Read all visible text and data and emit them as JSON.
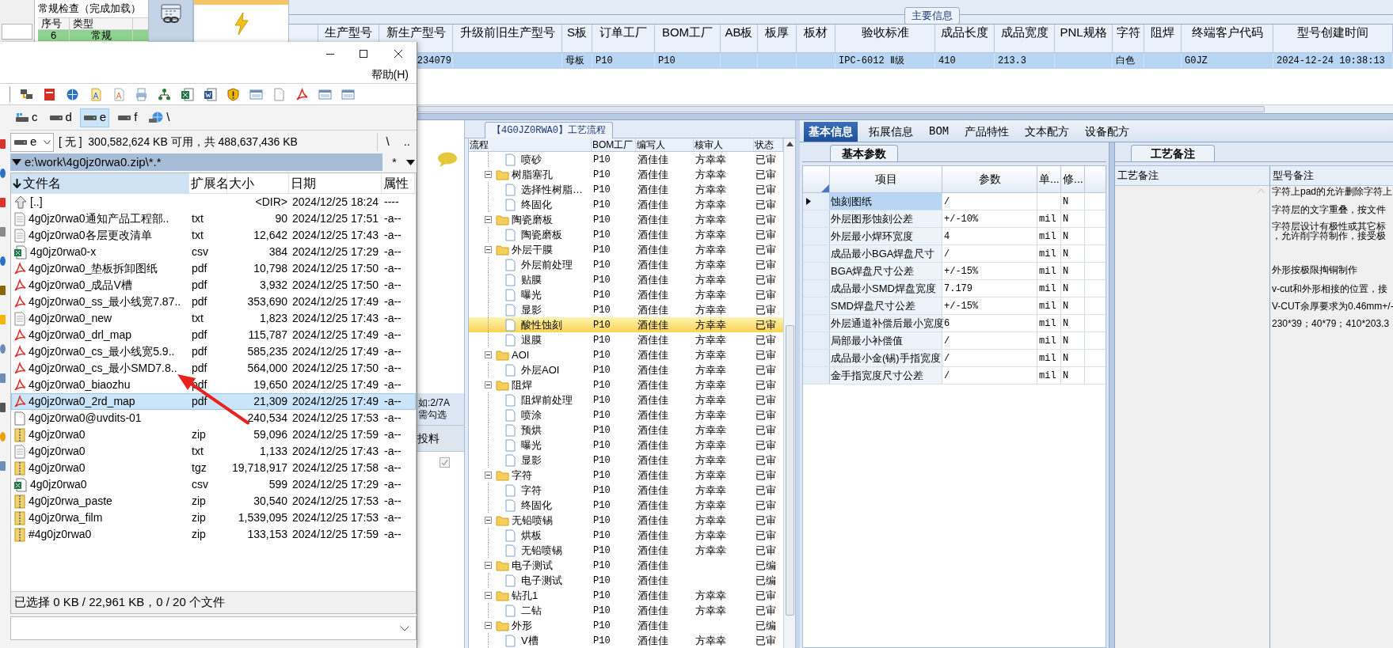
{
  "check_panel": {
    "title": "常规检查（完成加载）",
    "columns": [
      "序号",
      "类型"
    ],
    "row": [
      "6",
      "常规"
    ]
  },
  "main_info": {
    "title": "主要信息",
    "row_selected": true,
    "columns": [
      {
        "label": "生产型号"
      },
      {
        "label": "新生产型号",
        "value": "234079"
      },
      {
        "label": "升级前旧生产型号"
      },
      {
        "label": "S板",
        "value": "母板"
      },
      {
        "label": "订单工厂",
        "value": "P10"
      },
      {
        "label": "BOM工厂",
        "value": "P10"
      },
      {
        "label": "AB板"
      },
      {
        "label": "板厚"
      },
      {
        "label": "板材"
      },
      {
        "label": "验收标准",
        "value": "IPC-6012 Ⅱ级"
      },
      {
        "label": "成品长度",
        "value": "410"
      },
      {
        "label": "成品宽度",
        "value": "213.3"
      },
      {
        "label": "PNL规格"
      },
      {
        "label": "字符",
        "value": "白色"
      },
      {
        "label": "阻焊"
      },
      {
        "label": "终端客户代码",
        "value": "G0JZ"
      },
      {
        "label": "型号创建时间",
        "value": "2024-12-24 10:38:13"
      }
    ]
  },
  "side_panel": {
    "hint_lines": [
      "如:2/7A",
      "需勾选"
    ],
    "column": "投料",
    "checked": true
  },
  "process_flow": {
    "title": "【4G0JZ0RWA0】工艺流程",
    "columns": [
      "流程",
      "BOM工厂",
      "编写人",
      "核审人",
      "状态"
    ],
    "rows": [
      {
        "children": [
          {
            "name": "喷砂",
            "bom": "P10",
            "writer": "酒佳佳",
            "reviewer": "方幸幸",
            "status": "已审",
            "selected": false
          }
        ]
      },
      {
        "name": "树脂塞孔",
        "bom": "P10",
        "writer": "酒佳佳",
        "reviewer": "方幸幸",
        "status": "已审",
        "selected": false,
        "expanded": true,
        "children": [
          {
            "name": "选择性树脂…",
            "bom": "P10",
            "writer": "酒佳佳",
            "reviewer": "方幸幸",
            "status": "已审",
            "selected": false
          },
          {
            "name": "终固化",
            "bom": "P10",
            "writer": "酒佳佳",
            "reviewer": "方幸幸",
            "status": "已审",
            "selected": false
          }
        ]
      },
      {
        "name": "陶瓷磨板",
        "bom": "P10",
        "writer": "酒佳佳",
        "reviewer": "方幸幸",
        "status": "已审",
        "selected": false,
        "expanded": true,
        "children": [
          {
            "name": "陶瓷磨板",
            "bom": "P10",
            "writer": "酒佳佳",
            "reviewer": "方幸幸",
            "status": "已审",
            "selected": false
          }
        ]
      },
      {
        "name": "外层干膜",
        "bom": "P10",
        "writer": "酒佳佳",
        "reviewer": "方幸幸",
        "status": "已审",
        "selected": false,
        "expanded": true,
        "children": [
          {
            "name": "外层前处理",
            "bom": "P10",
            "writer": "酒佳佳",
            "reviewer": "方幸幸",
            "status": "已审",
            "selected": false
          },
          {
            "name": "贴膜",
            "bom": "P10",
            "writer": "酒佳佳",
            "reviewer": "方幸幸",
            "status": "已审",
            "selected": false
          },
          {
            "name": "曝光",
            "bom": "P10",
            "writer": "酒佳佳",
            "reviewer": "方幸幸",
            "status": "已审",
            "selected": false
          },
          {
            "name": "显影",
            "bom": "P10",
            "writer": "酒佳佳",
            "reviewer": "方幸幸",
            "status": "已审",
            "selected": false
          },
          {
            "name": "酸性蚀刻",
            "bom": "P10",
            "writer": "酒佳佳",
            "reviewer": "方幸幸",
            "status": "已审",
            "selected": true
          },
          {
            "name": "退膜",
            "bom": "P10",
            "writer": "酒佳佳",
            "reviewer": "方幸幸",
            "status": "已审",
            "selected": false
          }
        ]
      },
      {
        "name": "AOI",
        "bom": "P10",
        "writer": "酒佳佳",
        "reviewer": "方幸幸",
        "status": "已审",
        "selected": false,
        "expanded": true,
        "children": [
          {
            "name": "外层AOI",
            "bom": "P10",
            "writer": "酒佳佳",
            "reviewer": "方幸幸",
            "status": "已审",
            "selected": false
          }
        ]
      },
      {
        "name": "阻焊",
        "bom": "P10",
        "writer": "酒佳佳",
        "reviewer": "方幸幸",
        "status": "已审",
        "selected": false,
        "expanded": true,
        "children": [
          {
            "name": "阻焊前处理",
            "bom": "P10",
            "writer": "酒佳佳",
            "reviewer": "方幸幸",
            "status": "已审",
            "selected": false
          },
          {
            "name": "喷涂",
            "bom": "P10",
            "writer": "酒佳佳",
            "reviewer": "方幸幸",
            "status": "已审",
            "selected": false
          },
          {
            "name": "预烘",
            "bom": "P10",
            "writer": "酒佳佳",
            "reviewer": "方幸幸",
            "status": "已审",
            "selected": false
          },
          {
            "name": "曝光",
            "bom": "P10",
            "writer": "酒佳佳",
            "reviewer": "方幸幸",
            "status": "已审",
            "selected": false
          },
          {
            "name": "显影",
            "bom": "P10",
            "writer": "酒佳佳",
            "reviewer": "方幸幸",
            "status": "已审",
            "selected": false
          }
        ]
      },
      {
        "name": "字符",
        "bom": "P10",
        "writer": "酒佳佳",
        "reviewer": "方幸幸",
        "status": "已审",
        "selected": false,
        "expanded": true,
        "children": [
          {
            "name": "字符",
            "bom": "P10",
            "writer": "酒佳佳",
            "reviewer": "方幸幸",
            "status": "已审",
            "selected": false
          },
          {
            "name": "终固化",
            "bom": "P10",
            "writer": "酒佳佳",
            "reviewer": "方幸幸",
            "status": "已审",
            "selected": false
          }
        ]
      },
      {
        "name": "无铅喷锡",
        "bom": "P10",
        "writer": "酒佳佳",
        "reviewer": "方幸幸",
        "status": "已审",
        "selected": false,
        "expanded": true,
        "children": [
          {
            "name": "烘板",
            "bom": "P10",
            "writer": "酒佳佳",
            "reviewer": "方幸幸",
            "status": "已审",
            "selected": false
          },
          {
            "name": "无铅喷锡",
            "bom": "P10",
            "writer": "酒佳佳",
            "reviewer": "方幸幸",
            "status": "已审",
            "selected": false
          }
        ]
      },
      {
        "name": "电子测试",
        "bom": "P10",
        "writer": "酒佳佳",
        "status": "已编",
        "selected": false,
        "expanded": true,
        "children": [
          {
            "name": "电子测试",
            "bom": "P10",
            "writer": "酒佳佳",
            "status": "已编",
            "selected": false
          }
        ]
      },
      {
        "name": "钻孔1",
        "bom": "P10",
        "writer": "酒佳佳",
        "reviewer": "方幸幸",
        "status": "已审",
        "selected": false,
        "expanded": true,
        "children": [
          {
            "name": "二钻",
            "bom": "P10",
            "writer": "酒佳佳",
            "reviewer": "方幸幸",
            "status": "已审",
            "selected": false
          }
        ]
      },
      {
        "name": "外形",
        "bom": "P10",
        "writer": "酒佳佳",
        "status": "已编",
        "selected": false,
        "expanded": true,
        "children": [
          {
            "name": "V槽",
            "bom": "P10",
            "writer": "酒佳佳",
            "reviewer": "方幸幸",
            "status": "已审",
            "selected": false
          }
        ]
      }
    ]
  },
  "detail_tabs": [
    {
      "label": "基本信息",
      "selected": true
    },
    {
      "label": "拓展信息",
      "selected": false
    },
    {
      "label": "BOM",
      "selected": false
    },
    {
      "label": "产品特性",
      "selected": false
    },
    {
      "label": "文本配方",
      "selected": false
    },
    {
      "label": "设备配方",
      "selected": false
    }
  ],
  "basic_params": {
    "tab": "基本参数",
    "columns": [
      "项目",
      "参数",
      "单...",
      "修..."
    ],
    "rows": [
      {
        "item": "蚀刻图纸",
        "value": "/",
        "modified": "N",
        "selected": true
      },
      {
        "item": "外层图形蚀刻公差",
        "value": "+/-10%",
        "unit": "mil",
        "modified": "N",
        "selected": false
      },
      {
        "item": "外层最小焊环宽度",
        "value": "4",
        "unit": "mil",
        "modified": "N",
        "selected": false
      },
      {
        "item": "成品最小BGA焊盘尺寸",
        "value": "/",
        "unit": "mil",
        "modified": "N",
        "selected": false
      },
      {
        "item": "BGA焊盘尺寸公差",
        "value": "+/-15%",
        "unit": "mil",
        "modified": "N",
        "selected": false
      },
      {
        "item": "成品最小SMD焊盘宽度",
        "value": "7.179",
        "unit": "mil",
        "modified": "N",
        "selected": false
      },
      {
        "item": "SMD焊盘尺寸公差",
        "value": "+/-15%",
        "unit": "mil",
        "modified": "N",
        "selected": false
      },
      {
        "item": "外层通道补偿后最小宽度",
        "value": "6",
        "unit": "mil",
        "modified": "N",
        "selected": false
      },
      {
        "item": "局部最小补偿值",
        "value": "/",
        "unit": "mil",
        "modified": "N",
        "selected": false
      },
      {
        "item": "成品最小金(锡)手指宽度",
        "value": "/",
        "unit": "mil",
        "modified": "N",
        "selected": false
      },
      {
        "item": "金手指宽度尺寸公差",
        "value": "/",
        "unit": "mil",
        "modified": "N",
        "selected": false
      }
    ]
  },
  "notes": {
    "tab": "工艺备注",
    "columns": [
      "工艺备注",
      "型号备注"
    ],
    "model_notes": [
      "字符上pad的允许删除字符上",
      "字符层的文字重叠，按文件",
      "字符层设计有极性或其它标",
      "，允许削字符制作，接受极",
      "外形按极限掏铜制作",
      "v-cut和外形相接的位置，接",
      "V-CUT余厚要求为0.46mm+/-",
      "230*39；40*79；410*203.3"
    ]
  },
  "file_manager": {
    "menu": [
      "帮助(H)"
    ],
    "drives": [
      {
        "label": "c",
        "kind": "system",
        "selected": false
      },
      {
        "label": "d",
        "kind": "disk",
        "selected": false
      },
      {
        "label": "e",
        "kind": "disk",
        "selected": true
      },
      {
        "label": "f",
        "kind": "disk",
        "selected": false
      },
      {
        "label": "\\",
        "kind": "network",
        "selected": false
      }
    ],
    "drive_combo": "e",
    "free_space": "[ 无 ]  300,582,624 KB 可用，共 488,637,436 KB",
    "root_button": "\\",
    "up_button": "..",
    "path": "e:\\work\\4g0jz0rwa0.zip\\*.*",
    "filter": "*",
    "columns": [
      "文件名",
      "扩展名",
      "大小",
      "日期",
      "属性"
    ],
    "files": [
      {
        "kind": "up",
        "name": "[..]",
        "size": "<DIR>",
        "date": "2024/12/25 18:24",
        "attr": "----",
        "selected": false
      },
      {
        "kind": "text",
        "name": "4g0jz0rwa0通知产品工程部..",
        "ext": "txt",
        "size": "90",
        "date": "2024/12/25 17:51",
        "attr": "-a--",
        "selected": false
      },
      {
        "kind": "text",
        "name": "4g0jz0rwa0各层更改清单",
        "ext": "txt",
        "size": "12,642",
        "date": "2024/12/25 17:43",
        "attr": "-a--",
        "selected": false
      },
      {
        "kind": "sheet",
        "name": "4g0jz0rwa0-x",
        "ext": "csv",
        "size": "384",
        "date": "2024/12/25 17:29",
        "attr": "-a--",
        "selected": false
      },
      {
        "kind": "pdf",
        "name": "4g0jz0rwa0_垫板拆卸图纸",
        "ext": "pdf",
        "size": "10,798",
        "date": "2024/12/25 17:50",
        "attr": "-a--",
        "selected": false
      },
      {
        "kind": "pdf",
        "name": "4g0jz0rwa0_成品V槽",
        "ext": "pdf",
        "size": "3,932",
        "date": "2024/12/25 17:50",
        "attr": "-a--",
        "selected": false
      },
      {
        "kind": "pdf",
        "name": "4g0jz0rwa0_ss_最小线宽7.87..",
        "ext": "pdf",
        "size": "353,690",
        "date": "2024/12/25 17:49",
        "attr": "-a--",
        "selected": false
      },
      {
        "kind": "text",
        "name": "4g0jz0rwa0_new",
        "ext": "txt",
        "size": "1,823",
        "date": "2024/12/25 17:43",
        "attr": "-a--",
        "selected": false
      },
      {
        "kind": "pdf",
        "name": "4g0jz0rwa0_drl_map",
        "ext": "pdf",
        "size": "115,787",
        "date": "2024/12/25 17:49",
        "attr": "-a--",
        "selected": false
      },
      {
        "kind": "pdf",
        "name": "4g0jz0rwa0_cs_最小线宽5.9..",
        "ext": "pdf",
        "size": "585,235",
        "date": "2024/12/25 17:49",
        "attr": "-a--",
        "selected": false
      },
      {
        "kind": "pdf",
        "name": "4g0jz0rwa0_cs_最小SMD7.8..",
        "ext": "pdf",
        "size": "564,000",
        "date": "2024/12/25 17:50",
        "attr": "-a--",
        "selected": false
      },
      {
        "kind": "pdf",
        "name": "4g0jz0rwa0_biaozhu",
        "ext": "pdf",
        "size": "19,650",
        "date": "2024/12/25 17:49",
        "attr": "-a--",
        "selected": false
      },
      {
        "kind": "pdf",
        "name": "4g0jz0rwa0_2rd_map",
        "ext": "pdf",
        "size": "21,309",
        "date": "2024/12/25 17:49",
        "attr": "-a--",
        "selected": true
      },
      {
        "kind": "blank",
        "name": "4g0jz0rwa0@uvdits-01",
        "size": "240,534",
        "date": "2024/12/25 17:53",
        "attr": "-a--",
        "selected": false
      },
      {
        "kind": "archive",
        "name": "4g0jz0rwa0",
        "ext": "zip",
        "size": "59,096",
        "date": "2024/12/25 17:59",
        "attr": "-a--",
        "selected": false
      },
      {
        "kind": "text",
        "name": "4g0jz0rwa0",
        "ext": "txt",
        "size": "1,133",
        "date": "2024/12/25 17:43",
        "attr": "-a--",
        "selected": false
      },
      {
        "kind": "archive",
        "name": "4g0jz0rwa0",
        "ext": "tgz",
        "size": "19,718,917",
        "date": "2024/12/25 17:58",
        "attr": "-a--",
        "selected": false
      },
      {
        "kind": "sheet",
        "name": "4g0jz0rwa0",
        "ext": "csv",
        "size": "599",
        "date": "2024/12/25 17:29",
        "attr": "-a--",
        "selected": false
      },
      {
        "kind": "archive",
        "name": "4g0jz0rwa_paste",
        "ext": "zip",
        "size": "30,540",
        "date": "2024/12/25 17:53",
        "attr": "-a--",
        "selected": false
      },
      {
        "kind": "archive",
        "name": "4g0jz0rwa_film",
        "ext": "zip",
        "size": "1,539,095",
        "date": "2024/12/25 17:53",
        "attr": "-a--",
        "selected": false
      },
      {
        "kind": "archive",
        "name": "#4g0jz0rwa0",
        "ext": "zip",
        "size": "133,153",
        "date": "2024/12/25 17:59",
        "attr": "-a--",
        "selected": false
      }
    ],
    "status": "已选择 0 KB / 22,961 KB，0 / 20 个文件"
  }
}
